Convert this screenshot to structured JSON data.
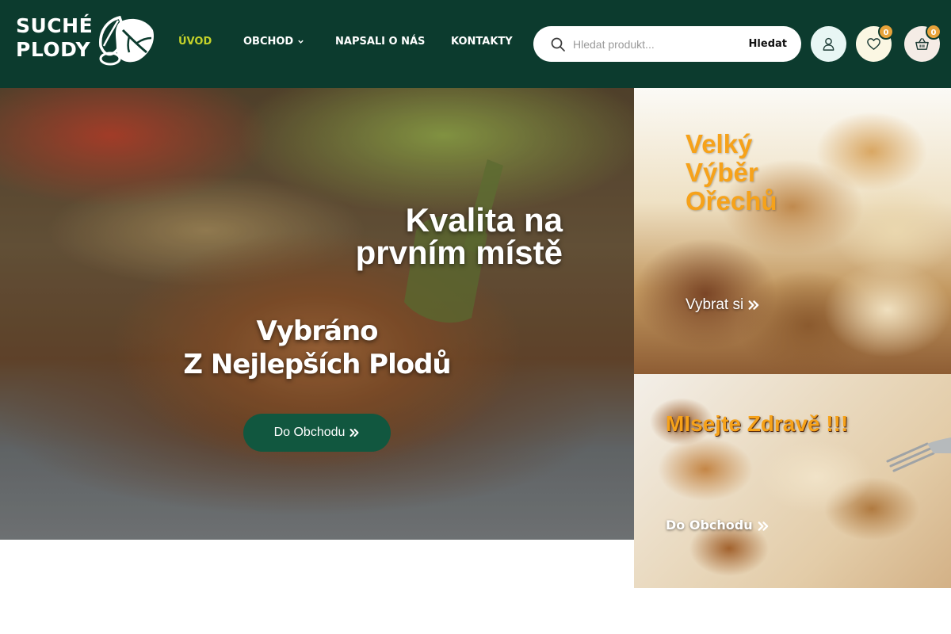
{
  "header": {
    "logo_text_line1": "SUCHÉ",
    "logo_text_line2": "PLODY",
    "nav": [
      {
        "label": "ÚVOD",
        "active": true
      },
      {
        "label": "OBCHOD",
        "has_dropdown": true
      },
      {
        "label": "NAPSALI O NÁS"
      },
      {
        "label": "KONTAKTY"
      }
    ],
    "search": {
      "placeholder": "Hledat produkt...",
      "value": "",
      "button_label": "Hledat"
    },
    "wishlist_count": "0",
    "cart_count": "0"
  },
  "hero": {
    "title": "Kvalita na prvním místě",
    "subtitle_line1": "Vybráno",
    "subtitle_line2": "Z Nejlepších Plodů",
    "button_label": "Do Obchodu"
  },
  "tiles": [
    {
      "title": "Velký Výběr Ořechů",
      "link_label": "Vybrat si"
    },
    {
      "title": "MIsejte Zdravě !!!",
      "link_label": "Do Obchodu"
    }
  ],
  "colors": {
    "header_bg": "#0c3b2e",
    "nav_active": "#c5d22a",
    "accent_orange": "#f6a21a",
    "badge": "#e8a33a",
    "hero_button": "#11573f"
  },
  "icons": [
    "search-icon",
    "user-icon",
    "heart-icon",
    "basket-icon",
    "chevron-down-icon",
    "double-chevron-right-icon",
    "leaf-logo-icon"
  ]
}
